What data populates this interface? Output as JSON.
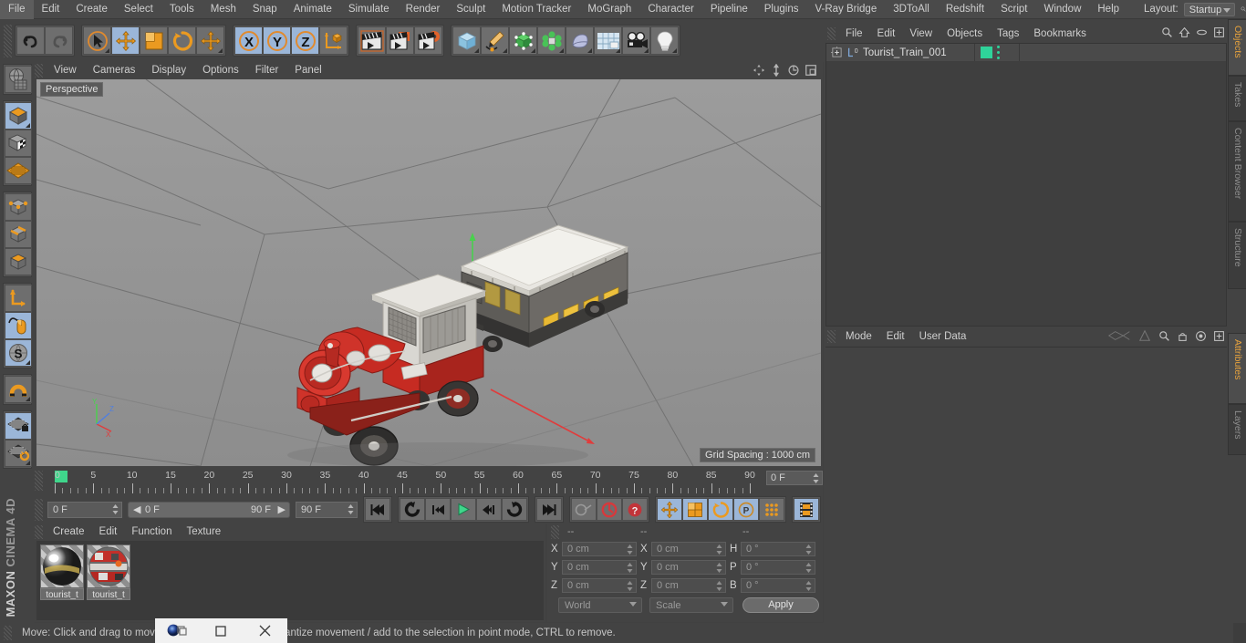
{
  "app": {
    "title": "MAXON CINEMA 4D",
    "brand_top": "MAXON",
    "brand_bottom": "CINEMA 4D"
  },
  "menubar": {
    "items": [
      "File",
      "Edit",
      "Create",
      "Select",
      "Tools",
      "Mesh",
      "Snap",
      "Animate",
      "Simulate",
      "Render",
      "Sculpt",
      "Motion Tracker",
      "MoGraph",
      "Character",
      "Pipeline",
      "Plugins",
      "V-Ray Bridge",
      "3DToAll",
      "Redshift",
      "Script",
      "Window",
      "Help"
    ],
    "layout_label": "Layout:",
    "layout_value": "Startup",
    "search_icon": "search-icon"
  },
  "toolbar": {
    "groups": [
      {
        "buttons": [
          {
            "name": "undo",
            "icon": "undo-arrow",
            "state": "off"
          },
          {
            "name": "redo",
            "icon": "redo-arrow",
            "state": "disabled"
          }
        ]
      },
      {
        "buttons": [
          {
            "name": "live-selection",
            "icon": "cursor-circle",
            "state": "off"
          },
          {
            "name": "move",
            "icon": "move-cross",
            "state": "on"
          },
          {
            "name": "scale",
            "icon": "scale-box",
            "state": "off"
          },
          {
            "name": "rotate",
            "icon": "rotate-ring",
            "state": "off"
          },
          {
            "name": "move-dup",
            "icon": "move-cross",
            "state": "off"
          }
        ]
      },
      {
        "buttons": [
          {
            "name": "lock-x",
            "icon": "axis-x",
            "state": "on"
          },
          {
            "name": "lock-y",
            "icon": "axis-y",
            "state": "on"
          },
          {
            "name": "lock-z",
            "icon": "axis-z",
            "state": "on"
          },
          {
            "name": "world-object-axis",
            "icon": "axis-cube",
            "state": "off"
          }
        ]
      },
      {
        "buttons": [
          {
            "name": "render-view",
            "icon": "clapper",
            "state": "off"
          },
          {
            "name": "render-to-picture-viewer",
            "icon": "clapper-orange",
            "state": "off"
          },
          {
            "name": "render-settings",
            "icon": "clapper-gear",
            "state": "off"
          }
        ]
      },
      {
        "buttons": [
          {
            "name": "add-cube",
            "icon": "cube-blue",
            "state": "off"
          },
          {
            "name": "add-spline",
            "icon": "pen-spline",
            "state": "off"
          },
          {
            "name": "add-generator",
            "icon": "cube-green",
            "state": "off"
          },
          {
            "name": "add-deformer",
            "icon": "deformer-green",
            "state": "off"
          },
          {
            "name": "add-scene",
            "icon": "shape-purple",
            "state": "off"
          },
          {
            "name": "add-environment",
            "icon": "floor-grid",
            "state": "off"
          },
          {
            "name": "add-camera",
            "icon": "camera",
            "state": "off"
          },
          {
            "name": "add-light",
            "icon": "lightbulb",
            "state": "off"
          }
        ]
      }
    ]
  },
  "lefttoolbar": {
    "groups": [
      {
        "buttons": [
          {
            "name": "make-editable",
            "icon": "globe-wire",
            "state": "off"
          }
        ]
      },
      {
        "buttons": [
          {
            "name": "model-mode",
            "icon": "cube-orange",
            "state": "on"
          },
          {
            "name": "texture-mode",
            "icon": "cube-checker",
            "state": "off"
          },
          {
            "name": "uv-mode",
            "icon": "grid-orange",
            "state": "off"
          }
        ]
      },
      {
        "buttons": [
          {
            "name": "points-mode",
            "icon": "cube-points",
            "state": "off"
          },
          {
            "name": "edges-mode",
            "icon": "cube-edges",
            "state": "off"
          },
          {
            "name": "polygons-mode",
            "icon": "cube-polys",
            "state": "off"
          }
        ]
      },
      {
        "buttons": [
          {
            "name": "enable-axis",
            "icon": "axis-L",
            "state": "off"
          },
          {
            "name": "viewport-solo",
            "icon": "mouse-spline",
            "state": "on"
          },
          {
            "name": "enable-snapping",
            "icon": "s-sphere",
            "state": "on"
          }
        ]
      },
      {
        "buttons": [
          {
            "name": "magnet-tool",
            "icon": "magnet",
            "state": "off"
          }
        ]
      },
      {
        "buttons": [
          {
            "name": "lock-workplane",
            "icon": "plane-lock",
            "state": "on"
          },
          {
            "name": "workplane-rotate",
            "icon": "plane-rotate",
            "state": "off"
          }
        ]
      }
    ]
  },
  "viewport": {
    "menu": [
      "View",
      "Cameras",
      "Display",
      "Options",
      "Filter",
      "Panel"
    ],
    "nav_icons": [
      "pan-icon",
      "dolly-icon",
      "orbit-icon",
      "maximize-icon"
    ],
    "label": "Perspective",
    "grid_spacing": "Grid Spacing : 1000 cm",
    "axis_labels": [
      "Y",
      "Z",
      "X"
    ],
    "scene_object": "Tourist train model (red locomotive with yellow passenger carriage)"
  },
  "timeline": {
    "ticks": [
      "0",
      "5",
      "10",
      "15",
      "20",
      "25",
      "30",
      "35",
      "40",
      "45",
      "50",
      "55",
      "60",
      "65",
      "70",
      "75",
      "80",
      "85",
      "90"
    ],
    "start": 0,
    "end": 90,
    "current_frame_field": "0 F"
  },
  "playbar": {
    "current_frame": "0 F",
    "range_start": "0 F",
    "range_end": "90 F",
    "preview_end": "90 F",
    "buttons": [
      {
        "name": "go-to-start",
        "icon": "skip-start",
        "state": "off"
      },
      {
        "name": "go-to-previous-key",
        "icon": "prev-key",
        "state": "off"
      },
      {
        "name": "step-back",
        "icon": "step-back",
        "state": "off"
      },
      {
        "name": "play-forwards",
        "icon": "play",
        "state": "off"
      },
      {
        "name": "step-forward",
        "icon": "step-forward",
        "state": "off"
      },
      {
        "name": "go-to-next-key",
        "icon": "next-key",
        "state": "off"
      },
      {
        "name": "go-to-end",
        "icon": "skip-end",
        "state": "off"
      },
      {
        "name": "record-active-objects",
        "icon": "key-gray",
        "state": "disabled"
      },
      {
        "name": "autokeying",
        "icon": "circle-red",
        "state": "off"
      },
      {
        "name": "keyframe-selection",
        "icon": "question-red",
        "state": "off"
      },
      {
        "name": "position-key",
        "icon": "move-cross",
        "state": "on"
      },
      {
        "name": "scale-key",
        "icon": "scale-box",
        "state": "on"
      },
      {
        "name": "rotation-key",
        "icon": "rotate-ring",
        "state": "on"
      },
      {
        "name": "param-key",
        "icon": "p-circle",
        "state": "on"
      },
      {
        "name": "point-level-animation",
        "icon": "dots-grid",
        "state": "off"
      },
      {
        "name": "animation-mode",
        "icon": "filmstrip",
        "state": "on"
      }
    ]
  },
  "material_manager": {
    "menu": [
      "Create",
      "Edit",
      "Function",
      "Texture"
    ],
    "materials": [
      {
        "name": "tourist_t",
        "type": "metal-chrome"
      },
      {
        "name": "tourist_t",
        "type": "train-texture"
      }
    ]
  },
  "coordinates": {
    "headers": [
      "--",
      "--",
      "--"
    ],
    "rows": [
      {
        "pos_label": "X",
        "pos_value": "0 cm",
        "size_label": "X",
        "size_value": "0 cm",
        "rot_label": "H",
        "rot_value": "0 °"
      },
      {
        "pos_label": "Y",
        "pos_value": "0 cm",
        "size_label": "Y",
        "size_value": "0 cm",
        "rot_label": "P",
        "rot_value": "0 °"
      },
      {
        "pos_label": "Z",
        "pos_value": "0 cm",
        "size_label": "Z",
        "size_value": "0 cm",
        "rot_label": "B",
        "rot_value": "0 °"
      }
    ],
    "system": "World",
    "mode": "Scale",
    "apply_label": "Apply"
  },
  "object_manager": {
    "menu": [
      "File",
      "Edit",
      "View",
      "Objects",
      "Tags",
      "Bookmarks"
    ],
    "icons": [
      "search-icon",
      "home-icon",
      "ellipse-icon",
      "add-panel-icon"
    ],
    "objects": [
      {
        "name": "Tourist_Train_001",
        "layer_badge": "0",
        "expandable": true,
        "tag_color": "#2fd39a"
      }
    ]
  },
  "attributes_manager": {
    "menu": [
      "Mode",
      "Edit",
      "User Data"
    ],
    "icons": [
      "backface-icon",
      "triangle-icon",
      "search-icon",
      "lock-icon",
      "target-icon",
      "add-panel-icon"
    ]
  },
  "right_tabs_top": [
    "Objects",
    "Takes",
    "Content Browser",
    "Structure"
  ],
  "right_tabs_bottom": [
    "Attributes",
    "Layers"
  ],
  "statusbar": {
    "message": "Move: Click and drag to move the selection, SHIFT to quantize movement / add to the selection in point mode, CTRL to remove."
  },
  "window_controls": {
    "restore": "restore-icon",
    "maximize": "maximize-icon",
    "close": "close-icon"
  },
  "colors": {
    "panel_bg": "#434343",
    "accent_orange": "#e8a33d",
    "active_blue": "#9bb6d8",
    "green_tag": "#2fd39a",
    "play_green": "#3fd68b"
  }
}
